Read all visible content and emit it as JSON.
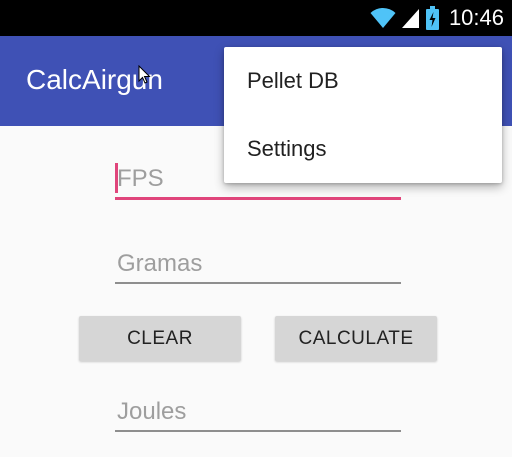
{
  "status_bar": {
    "time": "10:46",
    "icons": [
      "wifi-icon",
      "signal-icon",
      "battery-icon"
    ]
  },
  "app_bar": {
    "title": "CalcAirgun",
    "color": "#3f51b5"
  },
  "form": {
    "fps_placeholder": "FPS",
    "fps_value": "",
    "gramas_placeholder": "Gramas",
    "gramas_value": "",
    "joules_placeholder": "Joules",
    "joules_value": "",
    "clear_label": "CLEAR",
    "calculate_label": "CALCULATE",
    "accent_color": "#e0457b"
  },
  "overflow_menu": {
    "items": [
      {
        "label": "Pellet DB"
      },
      {
        "label": "Settings"
      }
    ]
  }
}
